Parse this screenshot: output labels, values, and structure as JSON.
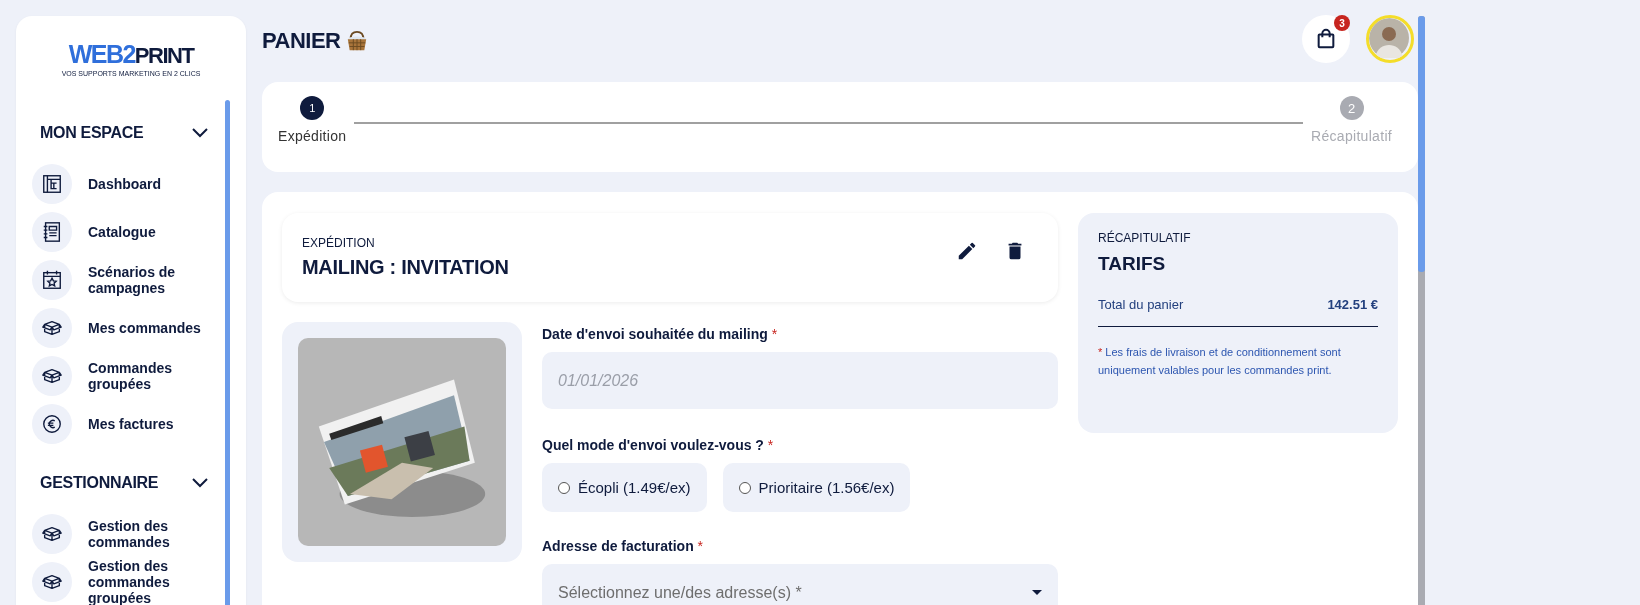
{
  "sidebar": {
    "logo": {
      "part_1": "WEB2",
      "part_2": "PRINT",
      "tagline": "VOS SUPPORTS MARKETING EN 2 CLICS"
    },
    "sections": [
      {
        "title": "MON ESPACE",
        "expanded": true,
        "items": [
          {
            "label": "Dashboard",
            "kind": "dashboard"
          },
          {
            "label": "Catalogue",
            "kind": "catalogue"
          },
          {
            "label": "Scénarios de campagnes",
            "kind": "calendar"
          },
          {
            "label": "Mes commandes",
            "kind": "box"
          },
          {
            "label": "Commandes groupées",
            "kind": "box"
          },
          {
            "label": "Mes factures",
            "kind": "euro"
          }
        ]
      },
      {
        "title": "GESTIONNAIRE",
        "expanded": true,
        "items": [
          {
            "label": "Gestion des commandes",
            "kind": "box"
          },
          {
            "label": "Gestion des commandes groupées",
            "kind": "box"
          }
        ]
      }
    ]
  },
  "header": {
    "title": "PANIER",
    "cart_badge": "3"
  },
  "stepper": [
    {
      "number": "1",
      "label": "Expédition",
      "selected": true
    },
    {
      "number": "2",
      "label": "Récapitulatif",
      "selected": false
    }
  ],
  "shipment": {
    "overline": "EXPÉDITION",
    "title": "MAILING : INVITATION"
  },
  "form": {
    "date": {
      "label": "Date d'envoi souhaitée du mailing",
      "required_mark": "*",
      "placeholder": "01/01/2026"
    },
    "mode": {
      "label": "Quel mode d'envoi voulez-vous ?",
      "required_mark": "*",
      "options": [
        {
          "label": "Écopli (1.49€/ex)",
          "selected": false
        },
        {
          "label": "Prioritaire (1.56€/ex)",
          "selected": false
        }
      ]
    },
    "billing": {
      "label": "Adresse de facturation",
      "required_mark": "*",
      "placeholder": "Sélectionnez une/des adresse(s) *"
    }
  },
  "summary": {
    "overline": "RÉCAPITULATIF",
    "title": "TARIFS",
    "total_label": "Total du panier",
    "total_value": "142.51 €",
    "note_mark": "*",
    "note": "Les frais de livraison et de conditionnement sont uniquement valables pour les commandes print."
  }
}
